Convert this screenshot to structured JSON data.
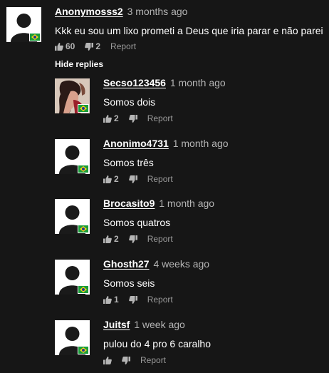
{
  "comments": {
    "main": {
      "username": "Anonymosss2",
      "time": "3 months ago",
      "text": "Kkk eu sou um lixo prometi a Deus que iria parar e não parei",
      "likes": "60",
      "dislikes": "2",
      "report_label": "Report"
    },
    "hide_replies_label": "Hide replies",
    "replies": [
      {
        "username": "Secso123456",
        "time": "1 month ago",
        "text": "Somos dois",
        "likes": "2",
        "report_label": "Report"
      },
      {
        "username": "Anonimo4731",
        "time": "1 month ago",
        "text": "Somos três",
        "likes": "2",
        "report_label": "Report"
      },
      {
        "username": "Brocasito9",
        "time": "1 month ago",
        "text": "Somos quatros",
        "likes": "2",
        "report_label": "Report"
      },
      {
        "username": "Ghosth27",
        "time": "4 weeks ago",
        "text": "Somos seis",
        "likes": "1",
        "report_label": "Report"
      },
      {
        "username": "Juitsf",
        "time": "1 week ago",
        "text": "pulou do 4 pro 6 caralho",
        "likes": "",
        "report_label": "Report"
      }
    ]
  },
  "icons": {
    "like": "thumbs-up-icon",
    "dislike": "thumbs-down-icon",
    "flag": "brazil-flag-icon",
    "avatar": "default-avatar-silhouette"
  },
  "colors": {
    "background": "#161616",
    "username": "#ffffff",
    "timestamp": "#b5b5b5",
    "meta": "#9a9a9a"
  }
}
